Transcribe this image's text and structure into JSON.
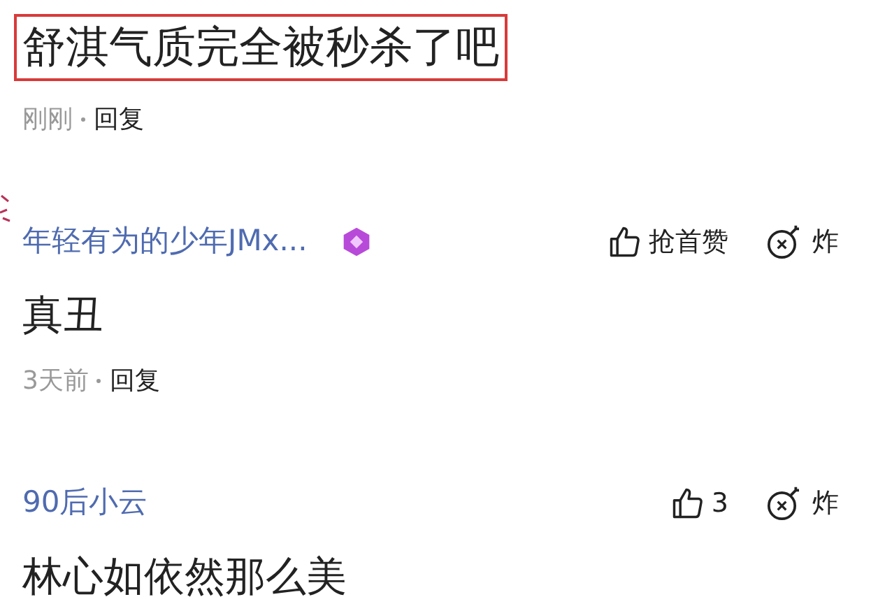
{
  "comments": [
    {
      "body": "舒淇气质完全被秒杀了吧",
      "highlighted": true,
      "time": "刚刚",
      "reply": "回复"
    },
    {
      "author": "年轻有为的少年JMx...",
      "has_badge": true,
      "like_label": "抢首赞",
      "bomb_label": "炸",
      "body": "真丑",
      "highlighted": false,
      "time": "3天前",
      "reply": "回复"
    },
    {
      "author": "90后小云",
      "has_badge": false,
      "like_label": "3",
      "bomb_label": "炸",
      "body": "林心如依然那么美",
      "highlighted": false
    }
  ]
}
